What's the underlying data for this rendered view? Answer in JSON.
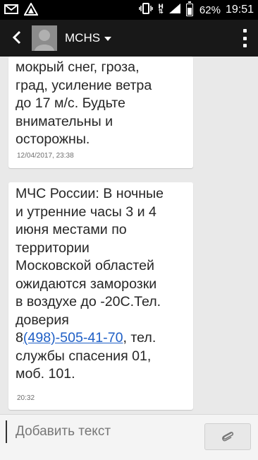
{
  "status_bar": {
    "icons": [
      "gmail-icon",
      "triangle-icon",
      "vibrate-icon",
      "data-arrows-icon",
      "signal-icon",
      "battery-icon"
    ],
    "data_indicator": "H",
    "battery_percent": "62%",
    "battery_level": 0.62,
    "time": "19:51"
  },
  "header": {
    "contact_name": "MCHS"
  },
  "messages": [
    {
      "text": "мокрый снег, гроза,\nград, усиление ветра\nдо 17 м/с. Будьте\nвнимательны и\nосторожны.",
      "timestamp": "12/04/2017, 23:38"
    },
    {
      "text_before_link": "МЧС России: В ночные\nи утренние часы 3 и 4\nиюня местами по\nтерритории\nМосковской областей\nожидаются заморозки\nв воздухе до -20С.Тел.\nдоверия\n8",
      "link": "(498)-505-41-70",
      "text_after_link": ", тел.\nслужбы спасения 01,\nмоб. 101.",
      "timestamp": "20:32"
    }
  ],
  "compose": {
    "placeholder": "Добавить текст"
  },
  "colors": {
    "status_bar_bg": "#000000",
    "action_bar_bg": "#181818",
    "chat_bg": "#e9e9e9",
    "bubble_bg": "#ffffff",
    "link": "#1f5fc6"
  }
}
